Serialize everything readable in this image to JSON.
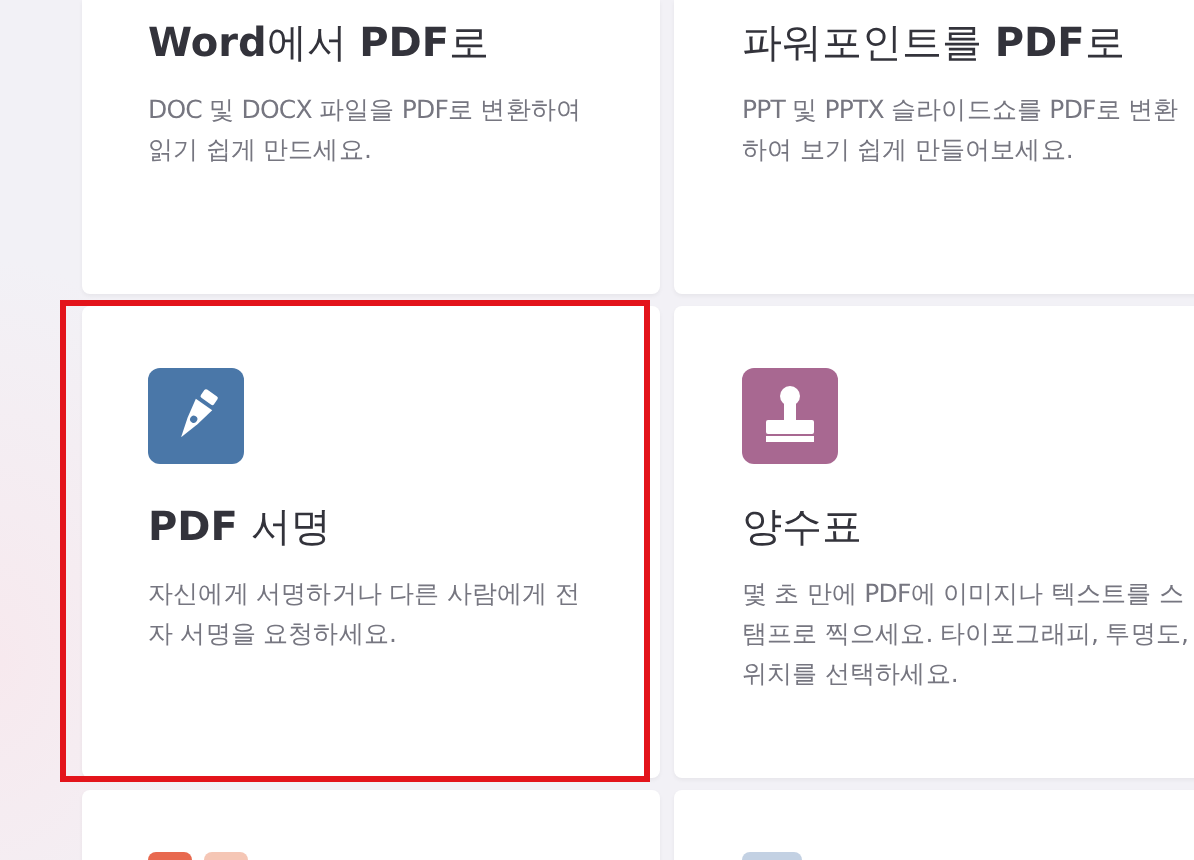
{
  "cards": [
    {
      "title": "**Word**에서 **PDF**로",
      "description": "DOC 및 DOCX 파일을 PDF로 변환하여 읽기 쉽게 만드세요.",
      "highlighted": false
    },
    {
      "title": "파워포인트를 **PDF**로",
      "description": "PPT 및 PPTX 슬라이드쇼를 PDF로 변환하여 보기 쉽게 만들어보세요.",
      "highlighted": false
    },
    {
      "kind": "pen",
      "title": "**PDF** 서명",
      "description": "자신에게 서명하거나 다른 사람에게 전자 서명을 요청하세요.",
      "highlighted": true
    },
    {
      "kind": "stamp",
      "title": "양수표",
      "description": "몇 초 만에 PDF에 이미지나 텍스트를 스탬프로 찍으세요. 타이포그래피, 투명도, 위치를 선택하세요.",
      "highlighted": false
    },
    {
      "kind": "warm-tiles",
      "highlighted": false
    },
    {
      "kind": "cool-tile",
      "highlighted": false
    }
  ]
}
